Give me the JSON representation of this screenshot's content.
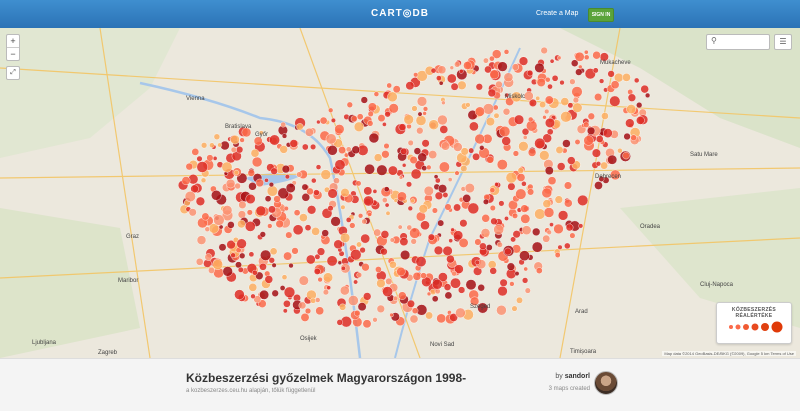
{
  "header": {
    "logo": "CART◎DB",
    "create_link": "Create a Map",
    "signin_button": "SIGN IN"
  },
  "map": {
    "zoom_in": "+",
    "zoom_out": "−",
    "fullscreen": "⤢",
    "search_icon": "search-icon",
    "layers_icon": "layers-icon",
    "attribution": "Map data ©2014 GeoBasis-DE/BKG (©2009), Google  5 km  Terms of Use",
    "place_labels": [
      "Vienna",
      "Bratislava",
      "Graz",
      "Maribor",
      "Ljubljana",
      "Zagreb",
      "Mukacheve",
      "Satu Mare",
      "Oradea",
      "Cluj-Napoca",
      "Arad",
      "Timișoara",
      "Novi Sad",
      "Osijek",
      "Győr",
      "Szeged",
      "Debrecen",
      "Miskolc"
    ],
    "colors": {
      "dark_red": "#a50f15",
      "red": "#de2d26",
      "orange": "#fb6a4a",
      "light_orange": "#fc9272",
      "yellow": "#fdae61"
    },
    "legend": {
      "title": "KÖZBESZERZÉS RÉALÉRTÉKE"
    }
  },
  "footer": {
    "title": "Közbeszerzési győzelmek Magyarországon 1998-",
    "subtitle": "a kozbeszerzes.ceu.hu alapján, tőlük függetlenül",
    "author_prefix": "by",
    "author_name": "sandorl",
    "maps_created": "3 maps created"
  }
}
